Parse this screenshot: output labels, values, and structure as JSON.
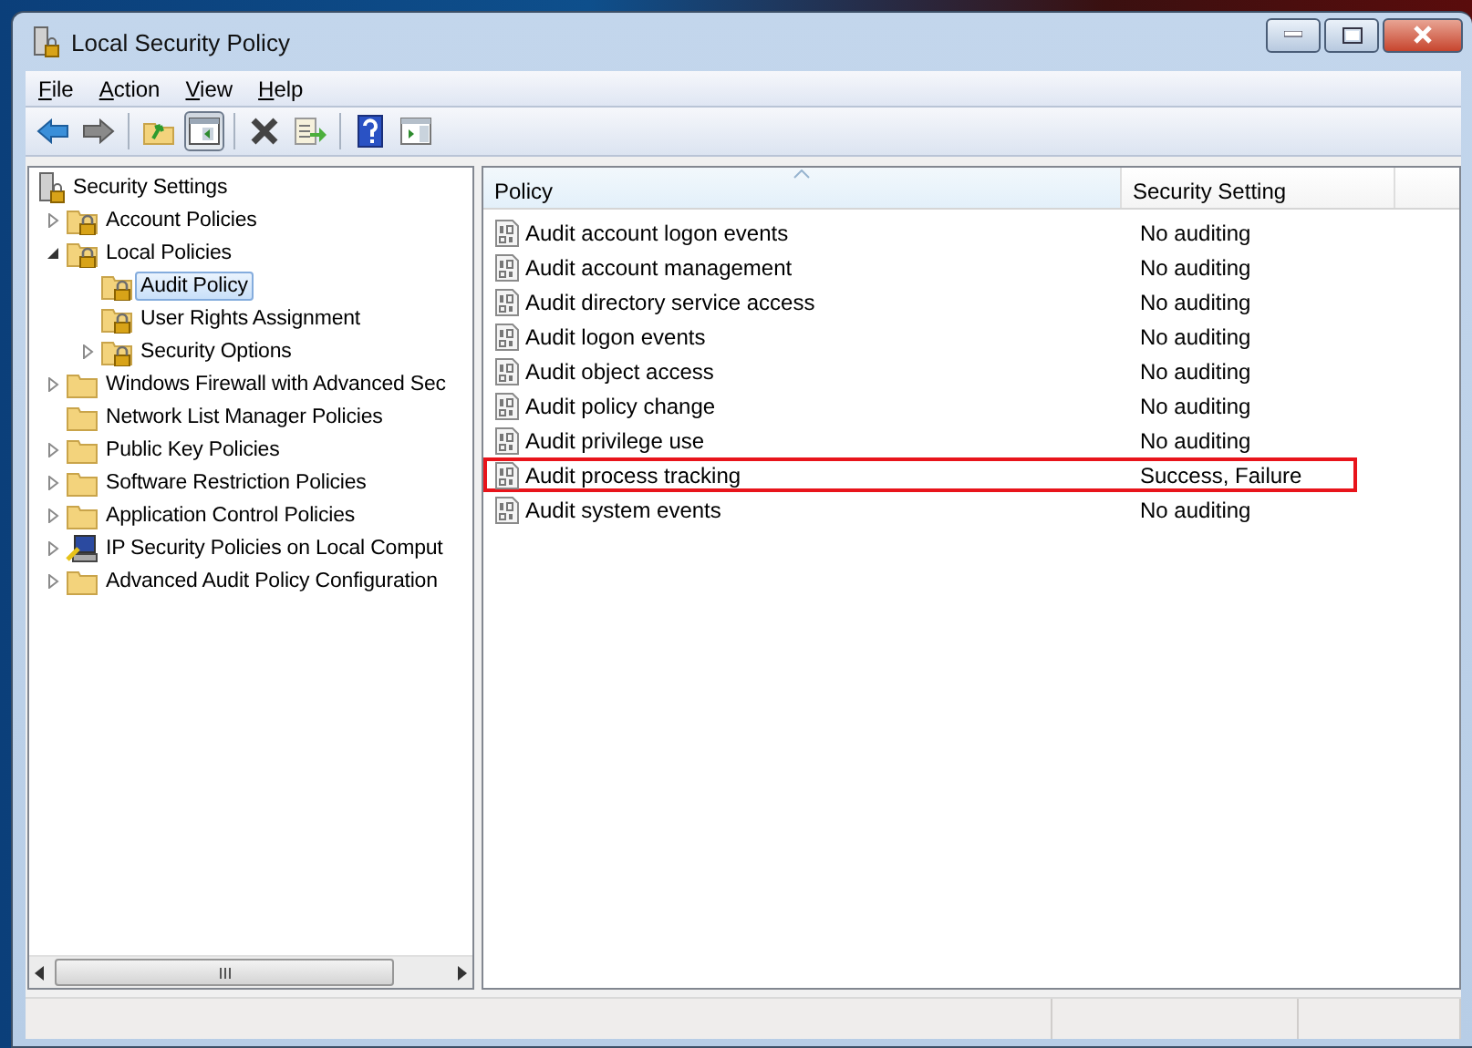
{
  "window": {
    "title": "Local Security Policy"
  },
  "menu": [
    {
      "label": "File"
    },
    {
      "label": "Action"
    },
    {
      "label": "View"
    },
    {
      "label": "Help"
    }
  ],
  "toolbar": [
    {
      "kind": "back",
      "pressed": false
    },
    {
      "kind": "forward",
      "pressed": false
    },
    {
      "kind": "separator"
    },
    {
      "kind": "up",
      "pressed": false
    },
    {
      "kind": "console-tree",
      "pressed": true
    },
    {
      "kind": "separator"
    },
    {
      "kind": "delete",
      "pressed": false
    },
    {
      "kind": "export",
      "pressed": false
    },
    {
      "kind": "separator"
    },
    {
      "kind": "help",
      "pressed": false
    },
    {
      "kind": "action-pane",
      "pressed": false
    }
  ],
  "tree": [
    {
      "label": "Security Settings",
      "kind": "server",
      "selected": false,
      "children": [
        {
          "label": "Account Policies",
          "kind": "lock-folder",
          "expanded": false,
          "selected": false
        },
        {
          "label": "Local Policies",
          "kind": "lock-folder",
          "expanded": true,
          "selected": false,
          "children": [
            {
              "label": "Audit Policy",
              "kind": "lock-folder",
              "selected": true
            },
            {
              "label": "User Rights Assignment",
              "kind": "lock-folder",
              "selected": false
            },
            {
              "label": "Security Options",
              "kind": "lock-folder",
              "expanded": false,
              "selected": false
            }
          ]
        },
        {
          "label": "Windows Firewall with Advanced Sec",
          "kind": "folder",
          "expanded": false,
          "selected": false
        },
        {
          "label": "Network List Manager Policies",
          "kind": "folder",
          "selected": false
        },
        {
          "label": "Public Key Policies",
          "kind": "folder",
          "expanded": false,
          "selected": false
        },
        {
          "label": "Software Restriction Policies",
          "kind": "folder",
          "expanded": false,
          "selected": false
        },
        {
          "label": "Application Control Policies",
          "kind": "folder",
          "expanded": false,
          "selected": false
        },
        {
          "label": "IP Security Policies on Local Comput",
          "kind": "computer",
          "expanded": false,
          "selected": false
        },
        {
          "label": "Advanced Audit Policy Configuration",
          "kind": "folder",
          "expanded": false,
          "selected": false
        }
      ]
    }
  ],
  "table": {
    "columns": [
      {
        "label": "Policy",
        "sorted": true
      },
      {
        "label": "Security Setting",
        "sorted": false
      }
    ],
    "rows": [
      {
        "policy": "Audit account logon events",
        "setting": "No auditing",
        "outlined": false
      },
      {
        "policy": "Audit account management",
        "setting": "No auditing",
        "outlined": false
      },
      {
        "policy": "Audit directory service access",
        "setting": "No auditing",
        "outlined": false
      },
      {
        "policy": "Audit logon events",
        "setting": "No auditing",
        "outlined": false
      },
      {
        "policy": "Audit object access",
        "setting": "No auditing",
        "outlined": false
      },
      {
        "policy": "Audit policy change",
        "setting": "No auditing",
        "outlined": false
      },
      {
        "policy": "Audit privilege use",
        "setting": "No auditing",
        "outlined": false
      },
      {
        "policy": "Audit process tracking",
        "setting": "Success, Failure",
        "outlined": true
      },
      {
        "policy": "Audit system events",
        "setting": "No auditing",
        "outlined": false
      }
    ]
  }
}
